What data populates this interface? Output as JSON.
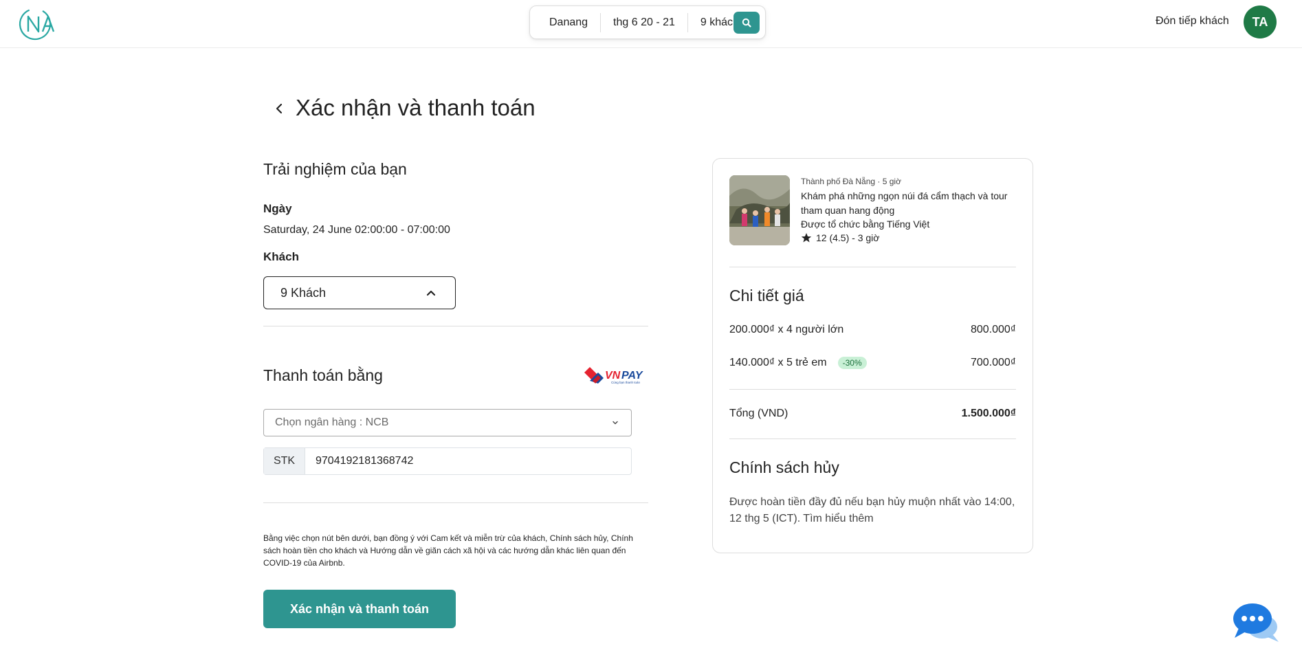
{
  "header": {
    "logo_text": "NA",
    "search": {
      "location": "Danang",
      "dates": "thg 6 20 - 21",
      "guests": "9 khách"
    },
    "host_link": "Đón tiếp khách",
    "avatar_initials": "TA"
  },
  "page": {
    "title": "Xác nhận và thanh toán"
  },
  "experience_section": {
    "title": "Trải nghiệm của bạn",
    "date_label": "Ngày",
    "date_value": "Saturday, 24 June 02:00:00 - 07:00:00",
    "guests_label": "Khách",
    "guests_value": "9 Khách"
  },
  "payment_section": {
    "title": "Thanh toán bằng",
    "provider_logo": "VNPAY",
    "provider_tagline": "Cùng bạn thanh toán",
    "bank_select": "Chọn ngân hàng : NCB",
    "account_label": "STK",
    "account_number": "9704192181368742",
    "terms": "Bằng việc chọn nút bên dưới, bạn đồng ý với Cam kết và miễn trừ của khách, Chính sách hủy, Chính sách hoàn tiền cho khách và Hướng dẫn về giãn cách xã hội và các hướng dẫn khác liên quan đến COVID-19 của Airbnb.",
    "confirm_button": "Xác nhận và thanh toán"
  },
  "summary_card": {
    "meta": "Thành phố Đà Nẵng · 5 giờ",
    "title": "Khám phá những ngọn núi đá cẩm thạch và tour tham quan hang động",
    "language": "Được tổ chức bằng Tiếng Việt",
    "rating": "12 (4.5) - 3 giờ",
    "price_title": "Chi tiết giá",
    "adult_line": "200.000₫ x 4 người lớn",
    "adult_total": "800.000₫",
    "child_line": "140.000₫ x 5 trẻ em",
    "child_discount": "-30%",
    "child_total": "700.000₫",
    "total_label": "Tổng (VND)",
    "total_value": "1.500.000₫",
    "policy_title": "Chính sách hủy",
    "policy_text": "Được hoàn tiền đầy đủ nếu bạn hủy muộn nhất vào 14:00, 12 thg 5 (ICT). Tìm hiểu thêm"
  },
  "colors": {
    "brand_teal": "#2e9590",
    "avatar_green": "#1f7a46",
    "chat_blue": "#1f7ae0",
    "discount_badge_bg": "#c9f0d6"
  },
  "icons": [
    "logo-na",
    "search-icon",
    "back-arrow-icon",
    "chevron-up-icon",
    "chevron-down-icon",
    "star-icon",
    "chat-icon"
  ]
}
